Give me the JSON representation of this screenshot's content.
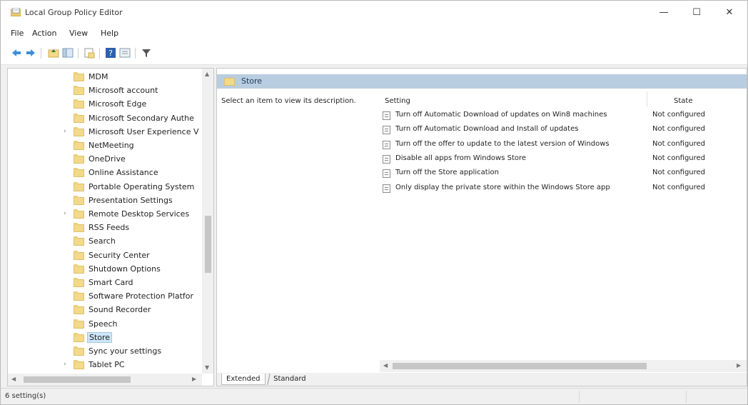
{
  "window": {
    "title": "Local Group Policy Editor",
    "minimize_glyph": "—",
    "maximize_glyph": "☐",
    "close_glyph": "✕"
  },
  "menu": [
    "File",
    "Action",
    "View",
    "Help"
  ],
  "toolbar": {
    "icons": [
      "back-arrow-icon",
      "forward-arrow-icon",
      "up-folder-icon",
      "show-hide-tree-icon",
      "export-list-icon",
      "help-icon",
      "properties-icon",
      "filter-icon"
    ]
  },
  "tree": {
    "items": [
      {
        "label": "MDM",
        "expandable": false
      },
      {
        "label": "Microsoft account",
        "expandable": false
      },
      {
        "label": "Microsoft Edge",
        "expandable": false
      },
      {
        "label": "Microsoft Secondary Authe",
        "expandable": false
      },
      {
        "label": "Microsoft User Experience V",
        "expandable": true
      },
      {
        "label": "NetMeeting",
        "expandable": false
      },
      {
        "label": "OneDrive",
        "expandable": false
      },
      {
        "label": "Online Assistance",
        "expandable": false
      },
      {
        "label": "Portable Operating System",
        "expandable": false
      },
      {
        "label": "Presentation Settings",
        "expandable": false
      },
      {
        "label": "Remote Desktop Services",
        "expandable": true
      },
      {
        "label": "RSS Feeds",
        "expandable": false
      },
      {
        "label": "Search",
        "expandable": false
      },
      {
        "label": "Security Center",
        "expandable": false
      },
      {
        "label": "Shutdown Options",
        "expandable": false
      },
      {
        "label": "Smart Card",
        "expandable": false
      },
      {
        "label": "Software Protection Platfor",
        "expandable": false
      },
      {
        "label": "Sound Recorder",
        "expandable": false
      },
      {
        "label": "Speech",
        "expandable": false
      },
      {
        "label": "Store",
        "expandable": false,
        "selected": true
      },
      {
        "label": "Sync your settings",
        "expandable": false
      },
      {
        "label": "Tablet PC",
        "expandable": true
      }
    ],
    "expand_glyph": "›"
  },
  "right": {
    "header": "Store",
    "description_prompt": "Select an item to view its description.",
    "columns": {
      "setting": "Setting",
      "state": "State"
    },
    "settings": [
      {
        "name": "Turn off Automatic Download of updates on Win8 machines",
        "state": "Not configured"
      },
      {
        "name": "Turn off Automatic Download and Install of updates",
        "state": "Not configured"
      },
      {
        "name": "Turn off the offer to update to the latest version of Windows",
        "state": "Not configured"
      },
      {
        "name": "Disable all apps from Windows Store",
        "state": "Not configured"
      },
      {
        "name": "Turn off the Store application",
        "state": "Not configured"
      },
      {
        "name": "Only display the private store within the Windows Store app",
        "state": "Not configured"
      }
    ],
    "tabs": [
      "Extended",
      "Standard"
    ]
  },
  "status": {
    "text": "6 setting(s)"
  },
  "colors": {
    "header_band": "#b9cde0",
    "folder": "#f3d98a",
    "selection": "#cde6f7"
  }
}
